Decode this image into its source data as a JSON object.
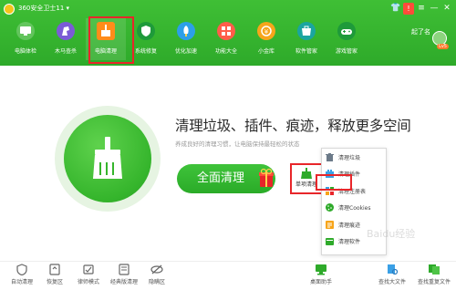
{
  "app": {
    "title": "360安全卫士11 ▾"
  },
  "window_controls": {
    "skin": "👕",
    "badge": "!",
    "menu": "≡",
    "minimize": "—",
    "close": "✕"
  },
  "nav": {
    "items": [
      {
        "label": "电脑体检",
        "icon": "monitor-icon"
      },
      {
        "label": "木马查杀",
        "icon": "horse-icon"
      },
      {
        "label": "电脑清理",
        "icon": "broom-icon",
        "active": true
      },
      {
        "label": "系统修复",
        "icon": "shield-icon"
      },
      {
        "label": "优化加速",
        "icon": "rocket-icon"
      },
      {
        "label": "功能大全",
        "icon": "grid-icon"
      },
      {
        "label": "小金库",
        "icon": "coin-icon"
      },
      {
        "label": "软件管家",
        "icon": "store-icon"
      },
      {
        "label": "游戏管家",
        "icon": "gamepad-icon"
      }
    ]
  },
  "user": {
    "label": "起了名",
    "badge": "Lv5"
  },
  "main": {
    "headline": "清理垃圾、插件、痕迹，释放更多空间",
    "subline": "养成良好的清理习惯，让电脑保持最轻松的状态",
    "clean_button": "全面清理",
    "quick_clean": "单项清理"
  },
  "dropdown": {
    "items": [
      {
        "label": "清理垃圾",
        "icon": "trash-icon"
      },
      {
        "label": "清理插件",
        "icon": "plugin-icon"
      },
      {
        "label": "清理注册表",
        "icon": "registry-icon"
      },
      {
        "label": "清理Cookies",
        "icon": "cookie-icon"
      },
      {
        "label": "清理痕迹",
        "icon": "trace-icon"
      },
      {
        "label": "清理软件",
        "icon": "software-icon"
      }
    ]
  },
  "bottom": {
    "left": [
      {
        "label": "自动清理",
        "icon": "auto-clean-icon"
      },
      {
        "label": "恢复区",
        "icon": "restore-icon"
      },
      {
        "label": "律师模式",
        "icon": "lawyer-icon"
      },
      {
        "label": "经典版清理",
        "icon": "classic-icon"
      },
      {
        "label": "隐瞒区",
        "icon": "hide-icon"
      }
    ],
    "right": [
      {
        "label": "桌面助手",
        "icon": "desktop-icon"
      },
      {
        "label": "查找大文件",
        "icon": "find-file-icon"
      },
      {
        "label": "查找重复文件",
        "icon": "duplicate-icon"
      }
    ]
  },
  "watermark": "Baidu经验",
  "colors": {
    "brand_green": "#2eaa2a",
    "highlight_red": "#e8262a",
    "accent_orange": "#ff8c1a"
  }
}
